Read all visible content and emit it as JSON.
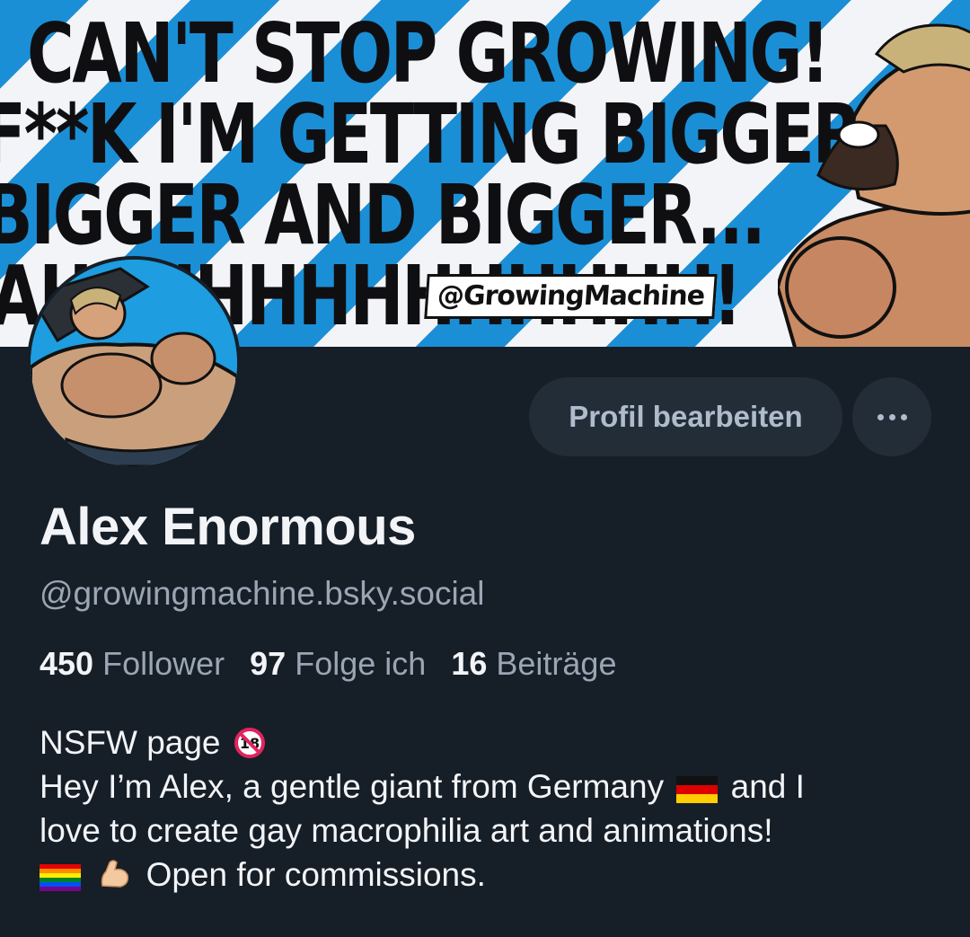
{
  "banner": {
    "line1": "CAN'T STOP GROWING!",
    "line2": "F**K I'M GETTING BIGGER",
    "line3": "BIGGER AND BIGGER...",
    "line4": "AHHHHHHHHHHHHH!",
    "tag": "@GrowingMachine"
  },
  "profile": {
    "name": "Alex Enormous",
    "handle": "@growingmachine.bsky.social",
    "edit_label": "Profil bearbeiten",
    "more_icon": "ellipsis-icon"
  },
  "stats": {
    "followers_count": "450",
    "followers_label": "Follower",
    "following_count": "97",
    "following_label": "Folge ich",
    "posts_count": "16",
    "posts_label": "Beiträge"
  },
  "bio": {
    "line1": "NSFW page",
    "line2": "Hey I’m Alex, a gentle giant from Germany",
    "line2b": "and I",
    "line3": "love to create gay macrophilia art and animations!",
    "line4": "Open for commissions.",
    "icons": [
      "no-under-18-icon",
      "german-flag-icon",
      "rainbow-flag-icon",
      "flexed-biceps-icon"
    ]
  },
  "colors": {
    "background": "#161e27",
    "button": "#232d38",
    "muted_text": "#9aa6b4",
    "banner_blue": "#1b8fd6"
  }
}
